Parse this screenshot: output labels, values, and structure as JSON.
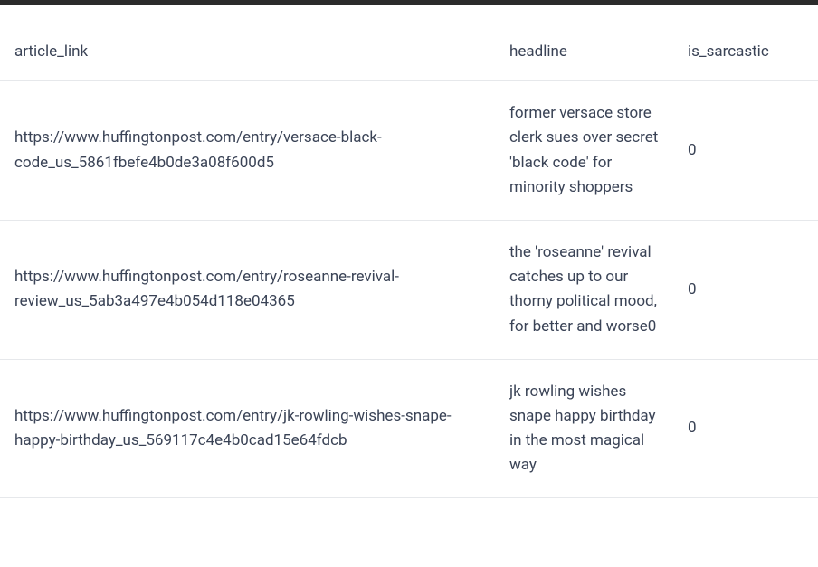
{
  "table": {
    "headers": {
      "article_link": "article_link",
      "headline": "headline",
      "is_sarcastic": "is_sarcastic"
    },
    "rows": [
      {
        "article_link": "https://www.huffingtonpost.com/entry/versace-black-code_us_5861fbefe4b0de3a08f600d5",
        "headline": "former versace store clerk sues over secret 'black code' for minority shoppers",
        "is_sarcastic": "0"
      },
      {
        "article_link": "https://www.huffingtonpost.com/entry/roseanne-revival-review_us_5ab3a497e4b054d118e04365",
        "headline": "the 'roseanne' revival catches up to our thorny political mood, for better and worse0",
        "is_sarcastic": "0"
      },
      {
        "article_link": "https://www.huffingtonpost.com/entry/jk-rowling-wishes-snape-happy-birthday_us_569117c4e4b0cad15e64fdcb",
        "headline": "jk rowling wishes snape happy birthday in the most magical way",
        "is_sarcastic": "0"
      }
    ]
  }
}
